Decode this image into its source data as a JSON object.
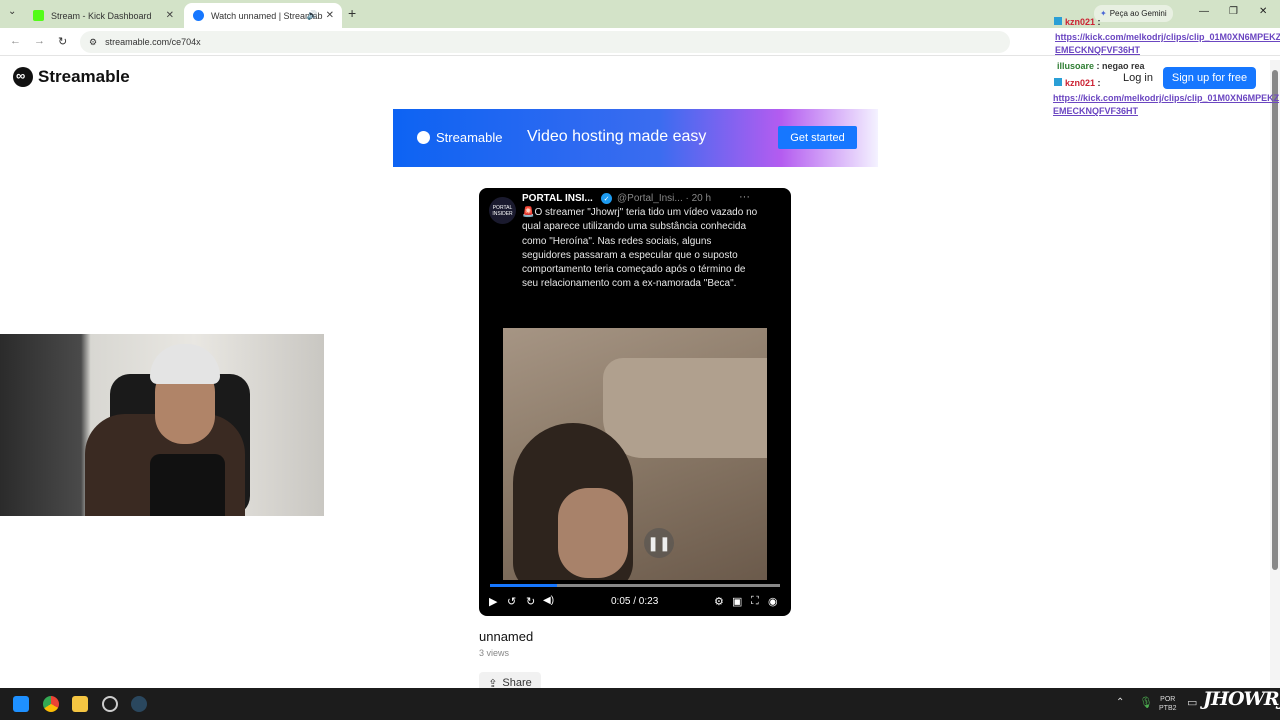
{
  "browser": {
    "tabs": [
      {
        "label": "Stream - Kick Dashboard",
        "favicon_color": "#53fc18"
      },
      {
        "label": "Watch unnamed | Streamab",
        "favicon_color": "#1677ff"
      }
    ],
    "url": "streamable.com/ce704x",
    "gemini_label": "Peça ao Gemini"
  },
  "site": {
    "logo_text": "Streamable",
    "login_label": "Log in",
    "signup_label": "Sign up for free"
  },
  "banner": {
    "logo_text": "Streamable",
    "tagline": "Video hosting made easy",
    "cta_label": "Get started"
  },
  "player": {
    "tweet": {
      "avatar_text": "PORTAL INSIDER",
      "author": "PORTAL INSI...",
      "handle": "@Portal_Insi... · 20 h",
      "text": "🚨O streamer \"Jhowrj\" teria tido um vídeo vazado no qual aparece utilizando uma substância conhecida como \"Heroína\". Nas redes sociais, alguns seguidores passaram a especular que o suposto comportamento teria começado após o término de seu relacionamento com a ex-namorada \"Beca\"."
    },
    "timecode": "0:05 / 0:23",
    "progress_fraction": 0.23
  },
  "video_meta": {
    "title": "unnamed",
    "views": "3 views",
    "share_label": "Share"
  },
  "chat": [
    {
      "user": "kzn021",
      "sep": " :",
      "msg": "",
      "user_color": "#cc2233"
    },
    {
      "user": "",
      "sep": "",
      "msg": "https://kick.com/melkodrj/clips/clip_01M0XN6MPEKZ",
      "user_color": "#6b46c1"
    },
    {
      "user": "",
      "sep": "",
      "msg": "EMECKNQFVF36HT",
      "user_color": "#6b46c1"
    },
    {
      "user": "illusoare",
      "sep": " :",
      "msg": "negao rea",
      "user_color": "#2e7d32"
    },
    {
      "user": "kzn021",
      "sep": " :",
      "msg": "",
      "user_color": "#cc2233"
    },
    {
      "user": "",
      "sep": "",
      "msg": "https://kick.com/melkodrj/clips/clip_01M0XN6MPEKZ",
      "user_color": "#6b46c1"
    },
    {
      "user": "",
      "sep": "",
      "msg": "EMECKNQFVF36HT",
      "user_color": "#6b46c1"
    }
  ],
  "taskbar": {
    "lang_top": "POR",
    "lang_bottom": "PTB2",
    "watermark": "JHOWRJ"
  }
}
